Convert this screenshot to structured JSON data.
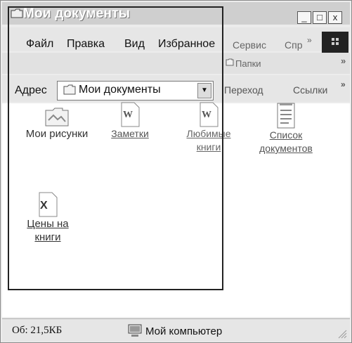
{
  "window": {
    "title": "Мои документы",
    "buttons": {
      "minimize": "_",
      "maximize": "□",
      "close": "x"
    }
  },
  "menubar": {
    "file": "Файл",
    "edit": "Правка",
    "view": "Вид",
    "favorites": "Избранное",
    "tools": "Сервис",
    "help": "Спр",
    "more": "»"
  },
  "toolbar": {
    "folders": "Папки",
    "more": "»"
  },
  "address": {
    "label": "Адрес",
    "value": "Мои документы",
    "go": "Переход",
    "links": "Ссылки",
    "links_more": "»"
  },
  "items": [
    {
      "label": "Мои рисунки",
      "icon": "folder-pictures-icon"
    },
    {
      "label": "Заметки",
      "icon": "word-document-icon"
    },
    {
      "label": "Любимые\nкниги",
      "icon": "word-document-icon"
    },
    {
      "label": "Список\nдокументов",
      "icon": "text-document-icon"
    },
    {
      "label": "Цены на\nкниги",
      "icon": "excel-document-icon"
    }
  ],
  "status": {
    "left": "Об: 21,5КБ",
    "right": "Мой компьютер"
  }
}
